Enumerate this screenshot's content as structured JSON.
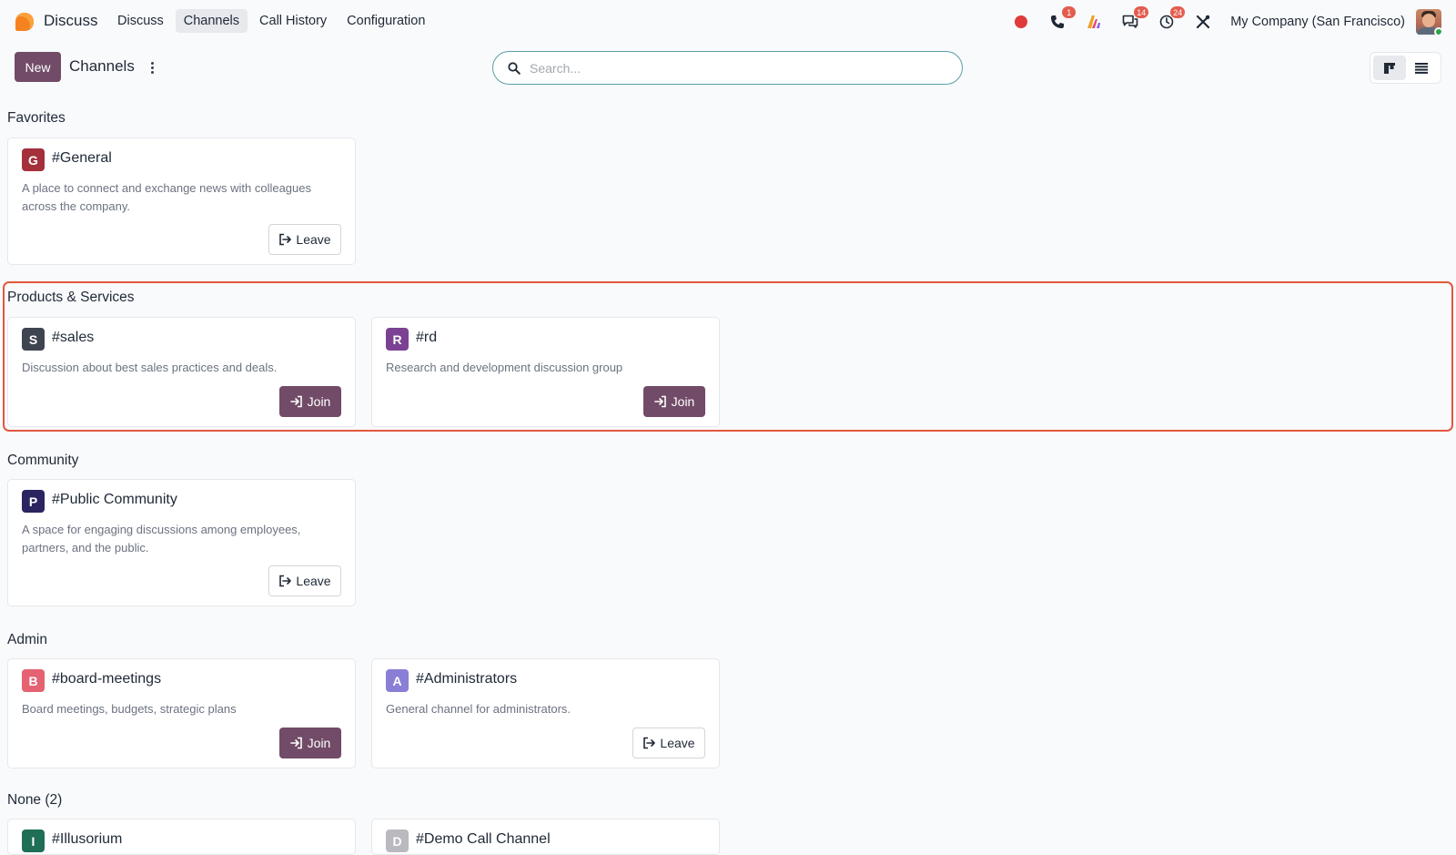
{
  "navbar": {
    "app_name": "Discuss",
    "menu": [
      "Discuss",
      "Channels",
      "Call History",
      "Configuration"
    ],
    "active_menu": "Channels",
    "badges": {
      "calls": "1",
      "messages": "14",
      "activities": "24"
    },
    "company": "My Company (San Francisco)"
  },
  "control_panel": {
    "new_label": "New",
    "title": "Channels",
    "search_placeholder": "Search..."
  },
  "groups": [
    {
      "title": "Favorites",
      "cards": [
        {
          "initial": "G",
          "color": "#a3303b",
          "name": "#General",
          "desc": "A place to connect and exchange news with colleagues across the company.",
          "action": "Leave"
        }
      ]
    },
    {
      "title": "Products & Services",
      "cards": [
        {
          "initial": "S",
          "color": "#3f4550",
          "name": "#sales",
          "desc": "Discussion about best sales practices and deals.",
          "action": "Join"
        },
        {
          "initial": "R",
          "color": "#7b4193",
          "name": "#rd",
          "desc": "Research and development discussion group",
          "action": "Join"
        }
      ]
    },
    {
      "title": "Community",
      "cards": [
        {
          "initial": "P",
          "color": "#2a2460",
          "name": "#Public Community",
          "desc": "A space for engaging discussions among employees, partners, and the public.",
          "action": "Leave"
        }
      ]
    },
    {
      "title": "Admin",
      "cards": [
        {
          "initial": "B",
          "color": "#e56272",
          "name": "#board-meetings",
          "desc": "Board meetings, budgets, strategic plans",
          "action": "Join"
        },
        {
          "initial": "A",
          "color": "#8a7fd6",
          "name": "#Administrators",
          "desc": "General channel for administrators.",
          "action": "Leave"
        }
      ]
    },
    {
      "title": "None (2)",
      "cards": [
        {
          "initial": "I",
          "color": "#1f6e56",
          "name": "#Illusorium"
        },
        {
          "initial": "D",
          "color": "#b9b9bf",
          "name": "#Demo Call Channel"
        }
      ]
    }
  ]
}
